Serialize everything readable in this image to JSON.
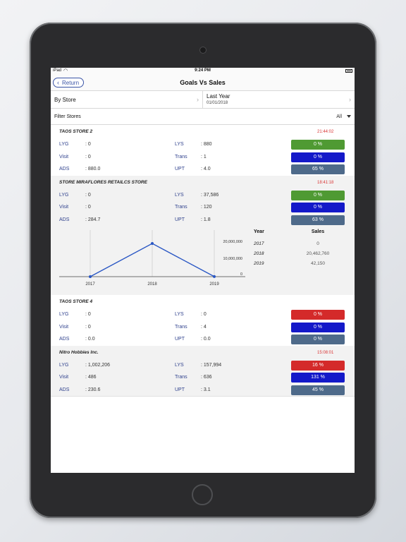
{
  "status_bar": {
    "carrier": "iPad",
    "time": "9:24 PM"
  },
  "nav": {
    "back_label": "Return",
    "title": "Goals Vs Sales"
  },
  "selectors": {
    "group_by": "By Store",
    "period_label": "Last Year",
    "period_date": "01/01/2018"
  },
  "filter": {
    "label": "Filter Stores",
    "value": "All"
  },
  "stores": [
    {
      "name": "TAOS STORE 2",
      "time": "21:44:02",
      "rows": [
        {
          "k1": "LYG",
          "v1": ": 0",
          "k2": "LYS",
          "v2": ": 880",
          "badge": "0 %",
          "color": "#4f9a33"
        },
        {
          "k1": "Visit",
          "v1": ": 0",
          "k2": "Trans",
          "v2": ": 1",
          "badge": "0 %",
          "color": "#1419c9"
        },
        {
          "k1": "ADS",
          "v1": ": 880.0",
          "k2": "UPT",
          "v2": ": 4.0",
          "badge": "65 %",
          "color": "#4e6a8a"
        }
      ]
    },
    {
      "name": "STORE MIRAFLORES RETAILCS STORE",
      "time": "18:41:18",
      "rows": [
        {
          "k1": "LYG",
          "v1": ": 0",
          "k2": "LYS",
          "v2": ": 37,586",
          "badge": "0 %",
          "color": "#4f9a33"
        },
        {
          "k1": "Visit",
          "v1": ": 0",
          "k2": "Trans",
          "v2": ": 120",
          "badge": "0 %",
          "color": "#1419c9"
        },
        {
          "k1": "ADS",
          "v1": ": 284.7",
          "k2": "UPT",
          "v2": ": 1.8",
          "badge": "63 %",
          "color": "#4e6a8a"
        }
      ]
    },
    {
      "name": "TAOS STORE 4",
      "time": "",
      "rows": [
        {
          "k1": "LYG",
          "v1": ": 0",
          "k2": "LYS",
          "v2": ": 0",
          "badge": "0 %",
          "color": "#d42a2a"
        },
        {
          "k1": "Visit",
          "v1": ": 0",
          "k2": "Trans",
          "v2": ": 4",
          "badge": "0 %",
          "color": "#1419c9"
        },
        {
          "k1": "ADS",
          "v1": ": 0.0",
          "k2": "UPT",
          "v2": ": 0.0",
          "badge": "0 %",
          "color": "#4e6a8a"
        }
      ]
    },
    {
      "name": "Nitro Hobbies Inc.",
      "time": "15:08:01",
      "rows": [
        {
          "k1": "LYG",
          "v1": ": 1,002,206",
          "k2": "LYS",
          "v2": ": 157,994",
          "badge": "16 %",
          "color": "#d42a2a"
        },
        {
          "k1": "Visit",
          "v1": ": 486",
          "k2": "Trans",
          "v2": ": 636",
          "badge": "131 %",
          "color": "#1419c9"
        },
        {
          "k1": "ADS",
          "v1": ": 230.6",
          "k2": "UPT",
          "v2": ": 3.1",
          "badge": "45 %",
          "color": "#4e6a8a"
        }
      ]
    }
  ],
  "chart_data": {
    "type": "line",
    "x": [
      "2017",
      "2018",
      "2019"
    ],
    "values": [
      0,
      20462760,
      42150
    ],
    "yticks": [
      "20,000,000",
      "10,000,000",
      "0"
    ],
    "ylim": [
      0,
      20462760
    ],
    "color": "#2a57c4"
  },
  "sales_table": {
    "headers": [
      "Year",
      "Sales"
    ],
    "rows": [
      {
        "year": "2017",
        "sales": "0"
      },
      {
        "year": "2018",
        "sales": "20,462,760"
      },
      {
        "year": "2019",
        "sales": "42,150"
      }
    ]
  }
}
